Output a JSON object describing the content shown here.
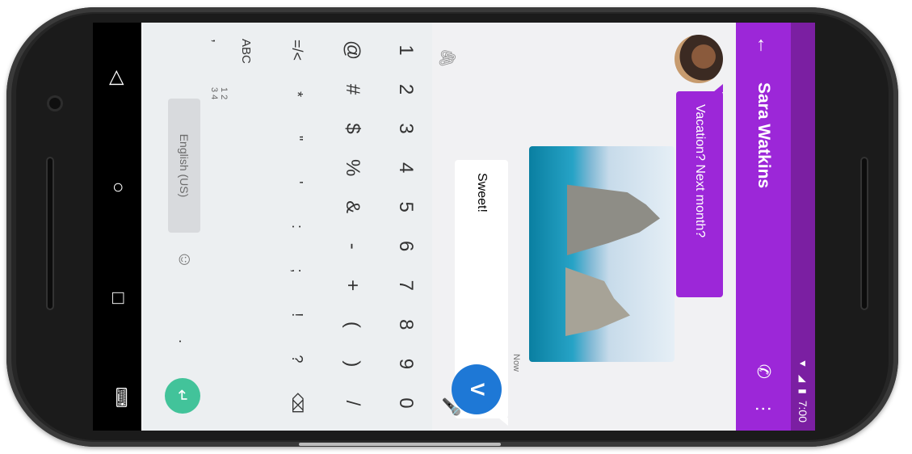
{
  "status": {
    "time": "7:00",
    "icons": [
      "wifi-icon",
      "signal-icon",
      "battery-icon"
    ]
  },
  "appbar": {
    "title": "Sara Watkins",
    "icons": [
      "arrow-back-icon",
      "phone-icon",
      "more-vert-icon"
    ]
  },
  "chat": {
    "incoming": {
      "text": "Vacation? Next month?"
    },
    "photo_label": "",
    "timestamp": "Now",
    "outgoing": {
      "text": "Sweet!"
    },
    "send_label": "V"
  },
  "keyboard": {
    "row_numbers": [
      "1",
      "2",
      "3",
      "4",
      "5",
      "6",
      "7",
      "8",
      "9",
      "0"
    ],
    "row_symbols1": [
      "@",
      "#",
      "$",
      "%",
      "&",
      "-",
      "+",
      "(",
      ")",
      "/"
    ],
    "row_symbols2": [
      "=/<",
      "*",
      "\"",
      "'",
      ":",
      ";",
      "!",
      "?",
      "⌫"
    ],
    "row_bottom": {
      "abc": "ABC",
      "comma": ",",
      "nums": "1 2\n3 4",
      "space": "English (US)",
      "emoji": "☺",
      "period": "."
    }
  },
  "navbar": {
    "icons": [
      "back-triangle-icon",
      "home-circle-icon",
      "recents-square-icon",
      "keyboard-icon"
    ]
  }
}
